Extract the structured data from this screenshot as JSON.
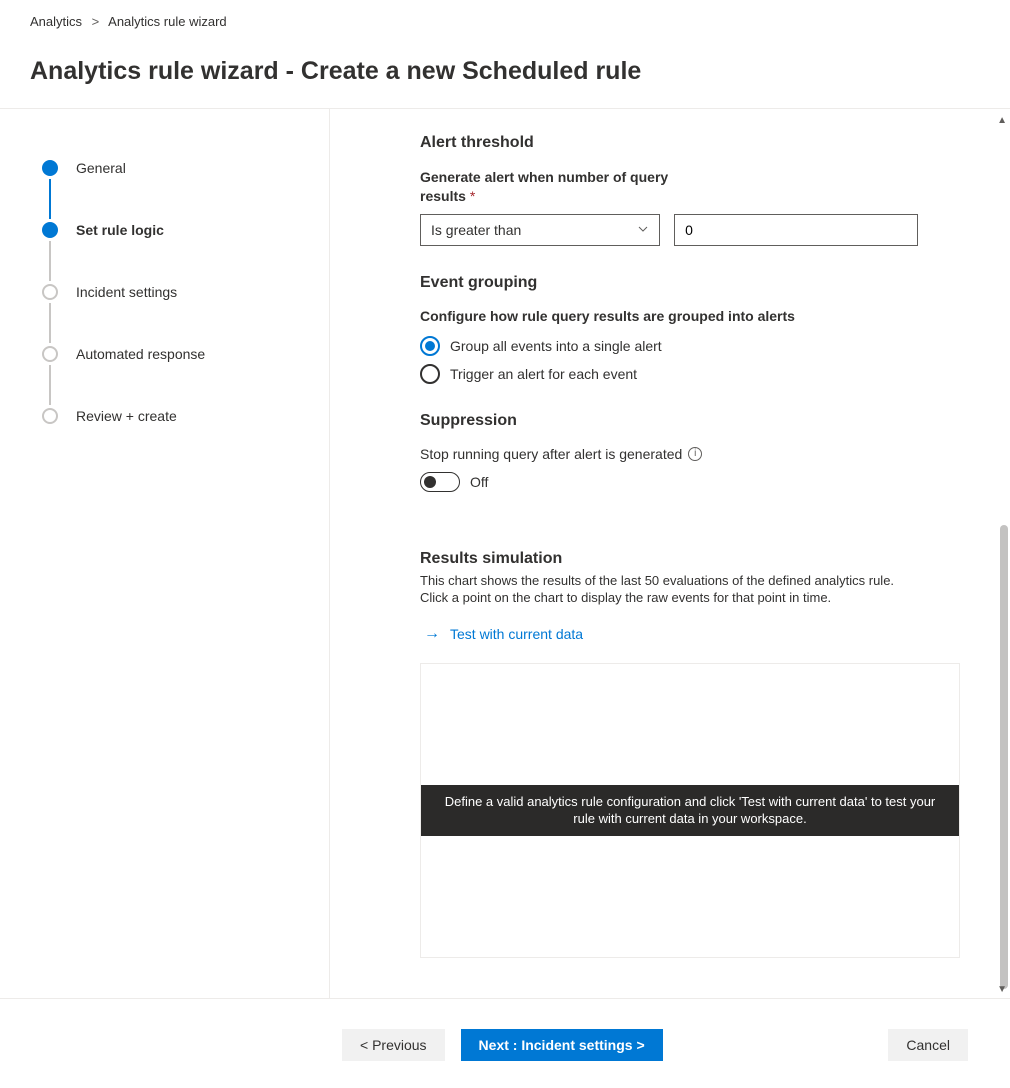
{
  "breadcrumb": {
    "root": "Analytics",
    "current": "Analytics rule wizard"
  },
  "page_title": "Analytics rule wizard - Create a new Scheduled rule",
  "stepper": {
    "items": [
      {
        "label": "General"
      },
      {
        "label": "Set rule logic"
      },
      {
        "label": "Incident settings"
      },
      {
        "label": "Automated response"
      },
      {
        "label": "Review + create"
      }
    ]
  },
  "alert_threshold": {
    "title": "Alert threshold",
    "label": "Generate alert when number of query results",
    "operator": "Is greater than",
    "value": "0"
  },
  "event_grouping": {
    "title": "Event grouping",
    "help": "Configure how rule query results are grouped into alerts",
    "option1": "Group all events into a single alert",
    "option2": "Trigger an alert for each event"
  },
  "suppression": {
    "title": "Suppression",
    "label": "Stop running query after alert is generated",
    "state": "Off"
  },
  "results": {
    "title": "Results simulation",
    "desc": "This chart shows the results of the last 50 evaluations of the defined analytics rule. Click a point on the chart to display the raw events for that point in time.",
    "test_link": "Test with current data",
    "banner": "Define a valid analytics rule configuration and click 'Test with current data' to test your rule with current data in your workspace."
  },
  "footer": {
    "previous": "< Previous",
    "next": "Next : Incident settings >",
    "cancel": "Cancel"
  }
}
